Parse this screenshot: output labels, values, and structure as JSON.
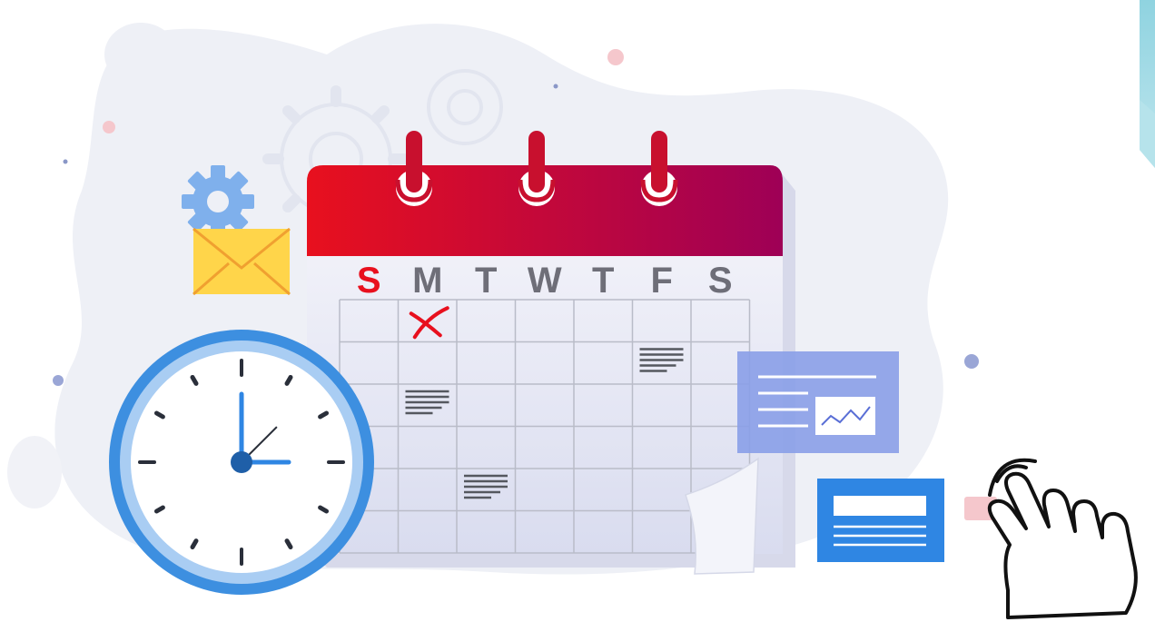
{
  "calendar": {
    "weekdays": [
      "S",
      "M",
      "T",
      "W",
      "T",
      "F",
      "S"
    ],
    "rows": 6,
    "marked_day": {
      "row": 0,
      "col": 1,
      "mark": "cross"
    },
    "notes": [
      {
        "row": 1,
        "col": 5
      },
      {
        "row": 2,
        "col": 1
      },
      {
        "row": 4,
        "col": 2
      }
    ]
  },
  "clock": {
    "hour": 3,
    "minute": 0
  },
  "colors": {
    "calendar_header_start": "#e8101e",
    "calendar_header_end": "#9e0056",
    "sunday_letter": "#e8101e",
    "weekday_letter": "#6e6e78",
    "clock_ring": "#3d8fe0",
    "clock_hands": "#2f86e3",
    "envelope": "#ffd54a",
    "card": "#2f86e3",
    "chart_panel": "#8a9ee8",
    "gear": "#7fb0ec",
    "background_blob": "#eef0f6"
  },
  "icons": [
    "gear-icon",
    "envelope-icon",
    "clock-icon",
    "chart-card-icon",
    "document-card-icon",
    "hand-pointer-icon"
  ]
}
